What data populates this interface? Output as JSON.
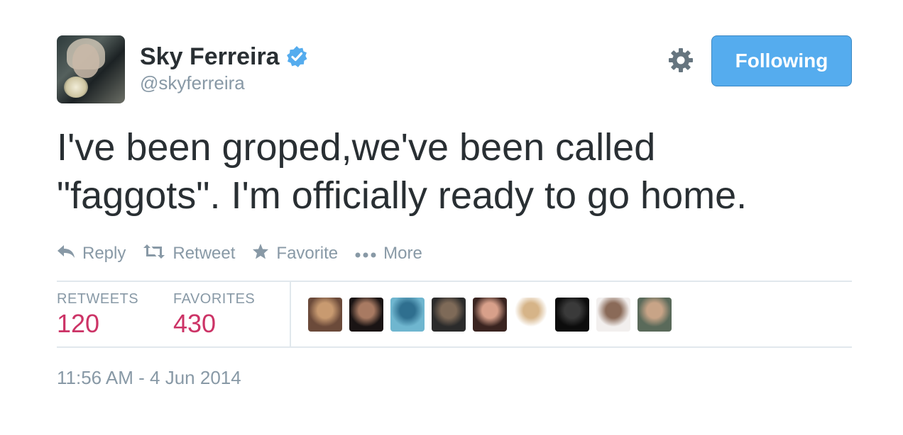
{
  "profile": {
    "name": "Sky Ferreira",
    "handle": "@skyferreira",
    "verified": true,
    "follow_label": "Following"
  },
  "tweet": {
    "text": "I've been groped,we've been called\n\"faggots\". I'm officially ready to go home.",
    "timestamp": "11:56 AM - 4 Jun 2014"
  },
  "actions": [
    {
      "label": "Reply",
      "icon": "reply-icon"
    },
    {
      "label": "Retweet",
      "icon": "retweet-icon"
    },
    {
      "label": "Favorite",
      "icon": "star-icon"
    },
    {
      "label": "More",
      "icon": "more-icon"
    }
  ],
  "stats": {
    "retweets_label": "RETWEETS",
    "retweets_count": "120",
    "favorites_label": "FAVORITES",
    "favorites_count": "430"
  },
  "favoriters": [
    {
      "icon": "user-avatar",
      "color_a": "#6b4a3a",
      "color_b": "#c89a70"
    },
    {
      "icon": "user-avatar",
      "color_a": "#1a1414",
      "color_b": "#a87a62"
    },
    {
      "icon": "user-avatar",
      "color_a": "#6fb6cf",
      "color_b": "#2f6f8f"
    },
    {
      "icon": "user-avatar",
      "color_a": "#2b2b2b",
      "color_b": "#7e6a58"
    },
    {
      "icon": "user-avatar",
      "color_a": "#3a2420",
      "color_b": "#d8a08a"
    },
    {
      "icon": "user-avatar",
      "color_a": "#ffffff",
      "color_b": "#d6b488"
    },
    {
      "icon": "user-avatar",
      "color_a": "#0c0c0c",
      "color_b": "#3a3a3a"
    },
    {
      "icon": "user-avatar",
      "color_a": "#f2efee",
      "color_b": "#8a6a58"
    },
    {
      "icon": "user-avatar",
      "color_a": "#5a6a5a",
      "color_b": "#c8a487"
    }
  ],
  "colors": {
    "accent": "#55acee",
    "count": "#cc3366",
    "muted": "#8899a6",
    "text": "#292f33",
    "verified": "#55acee"
  }
}
